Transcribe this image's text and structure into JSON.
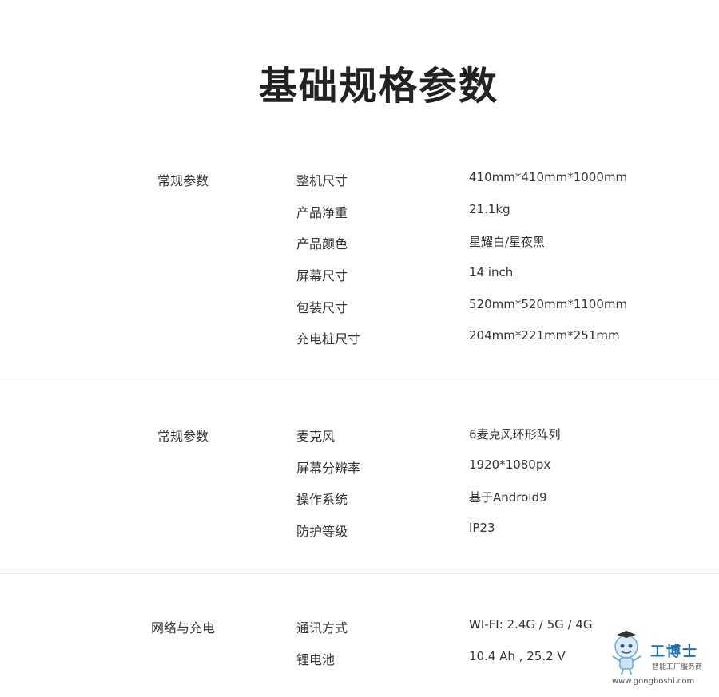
{
  "title": "基础规格参数",
  "sections": [
    {
      "label": "常规参数",
      "rows": [
        {
          "name": "整机尺寸",
          "value": "410mm*410mm*1000mm"
        },
        {
          "name": "产品净重",
          "value": "21.1kg"
        },
        {
          "name": "产品颜色",
          "value": "星耀白/星夜黑"
        },
        {
          "name": "屏幕尺寸",
          "value": "14 inch"
        },
        {
          "name": "包装尺寸",
          "value": "520mm*520mm*1100mm"
        },
        {
          "name": "充电桩尺寸",
          "value": "204mm*221mm*251mm"
        }
      ]
    },
    {
      "label": "常规参数",
      "rows": [
        {
          "name": "麦克风",
          "value": "6麦克风环形阵列"
        },
        {
          "name": "屏幕分辨率",
          "value": "1920*1080px"
        },
        {
          "name": "操作系统",
          "value": "基于Android9"
        },
        {
          "name": "防护等级",
          "value": "IP23"
        }
      ]
    },
    {
      "label": "网络与充电",
      "rows": [
        {
          "name": "通讯方式",
          "value": "WI-FI: 2.4G / 5G / 4G"
        },
        {
          "name": "锂电池",
          "value": "10.4 Ah , 25.2 V"
        }
      ]
    }
  ],
  "watermark": {
    "brand": "工博士",
    "slogan": "智能工厂服务商",
    "url": "www.gongboshi.com",
    "icon": "robot-mascot-icon",
    "brand_color": "#1a6fb3"
  }
}
